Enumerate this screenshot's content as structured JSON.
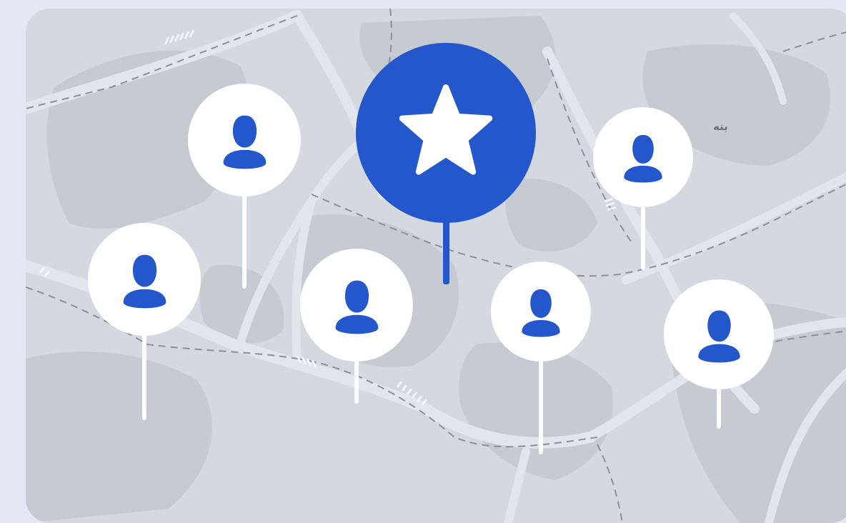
{
  "map": {
    "label": "بنه",
    "colors": {
      "page": "#e3e8f5",
      "land": "#d4d8e0",
      "block": "#c6cad3",
      "road": "#e2e5eb",
      "accent": "#2557cc",
      "pin": "#ffffff"
    }
  },
  "pins": [
    {
      "name": "featured-pin",
      "icon": "star-icon",
      "type": "featured"
    },
    {
      "name": "person-pin",
      "icon": "person-icon",
      "type": "person"
    },
    {
      "name": "person-pin",
      "icon": "person-icon",
      "type": "person"
    },
    {
      "name": "person-pin",
      "icon": "person-icon",
      "type": "person"
    },
    {
      "name": "person-pin",
      "icon": "person-icon",
      "type": "person"
    },
    {
      "name": "person-pin",
      "icon": "person-icon",
      "type": "person"
    },
    {
      "name": "person-pin",
      "icon": "person-icon",
      "type": "person"
    }
  ]
}
